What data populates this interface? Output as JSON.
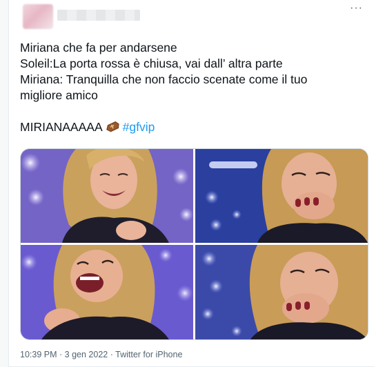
{
  "tweet": {
    "more_glyph": "···",
    "lines": [
      "Miriana che fa per andarsene",
      "Soleil:La porta rossa è chiusa, vai dall’ altra parte",
      "Miriana: Tranquilla che non faccio scenate come il tuo",
      "migliore amico"
    ],
    "shout": "MIRIANAAAAA",
    "emoji": "coffin-emoji",
    "hashtag": "#gfvip"
  },
  "media": {
    "images": [
      {
        "name": "photo-laughing-1"
      },
      {
        "name": "photo-laughing-2"
      },
      {
        "name": "photo-laughing-3"
      },
      {
        "name": "photo-laughing-4"
      }
    ]
  },
  "meta": {
    "time": "10:39 PM",
    "separator": "·",
    "date": "3 gen 2022",
    "source": "Twitter for iPhone"
  },
  "colors": {
    "text": "#0f1419",
    "link": "#1d9bf0",
    "secondary": "#536471",
    "stage_blue": "#2a3f9e"
  }
}
